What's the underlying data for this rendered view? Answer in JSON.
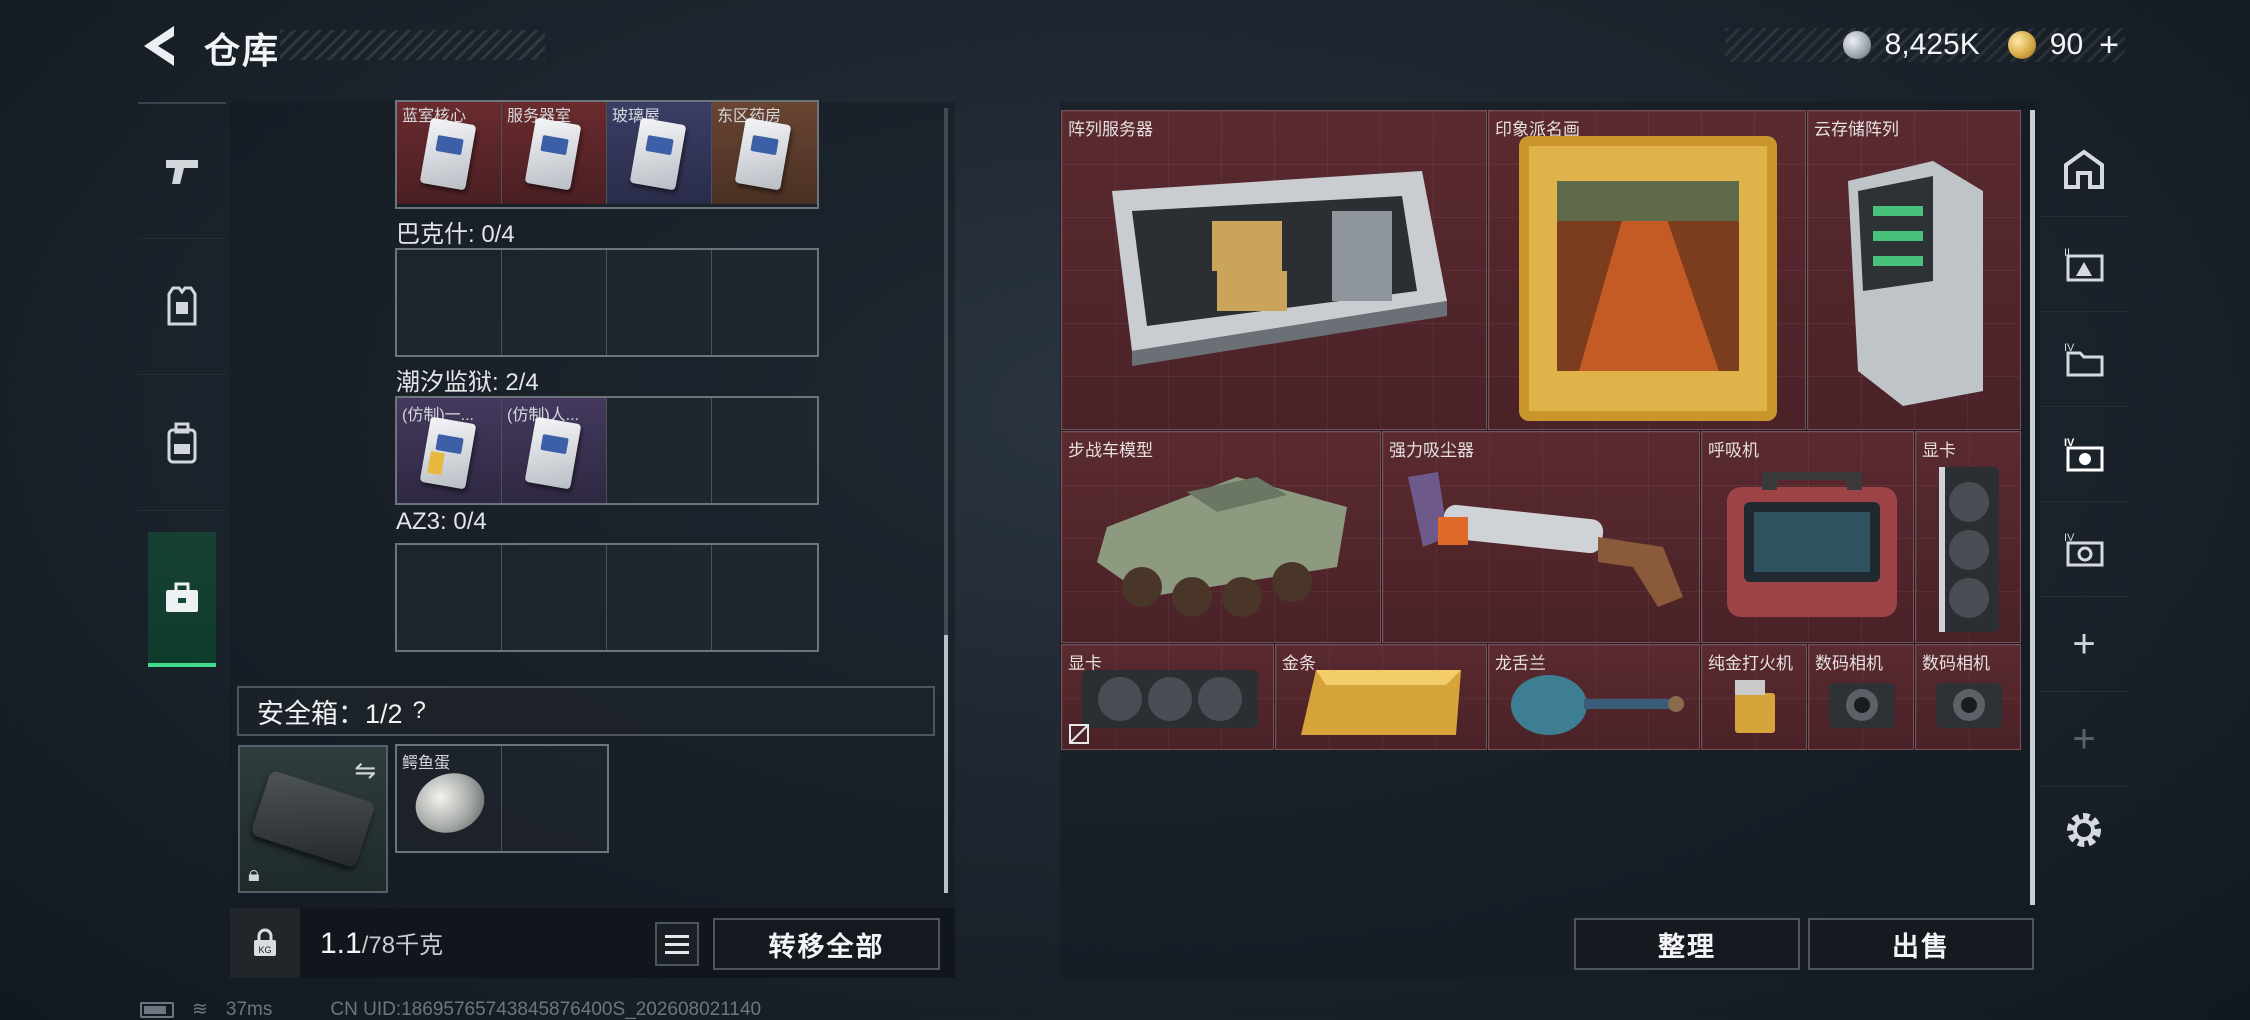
{
  "header": {
    "title": "仓库"
  },
  "currency": {
    "silver": "8,425K",
    "gold": "90",
    "gold_plus": "+"
  },
  "left_tabs": [
    {
      "icon": "pistol-icon"
    },
    {
      "icon": "armor-icon"
    },
    {
      "icon": "backpack-icon"
    },
    {
      "icon": "briefcase-icon",
      "active": true
    }
  ],
  "key_groups": [
    {
      "label": "",
      "slots": [
        "蓝室核心",
        "服务器室",
        "玻璃屋",
        "东区药房"
      ]
    },
    {
      "label": "巴克什: 0/4",
      "slots": [
        "",
        "",
        "",
        ""
      ]
    },
    {
      "label": "潮汐监狱: 2/4",
      "slots": [
        "(仿制)一...",
        "(仿制)人...",
        "",
        ""
      ]
    },
    {
      "label": "AZ3: 0/4",
      "slots": [
        "",
        "",
        "",
        ""
      ]
    }
  ],
  "safe_box": {
    "label": "安全箱：1/2",
    "help": "?",
    "item": "鳄鱼蛋"
  },
  "weight": {
    "value": "1.1",
    "unit": "/78千克"
  },
  "buttons": {
    "transfer_all": "转移全部",
    "organize": "整理",
    "sell": "出售"
  },
  "stash_items": [
    {
      "name": "阵列服务器",
      "icon": "server-icon"
    },
    {
      "name": "印象派名画",
      "icon": "painting-icon"
    },
    {
      "name": "云存储阵列",
      "icon": "storage-array-icon"
    },
    {
      "name": "步战车模型",
      "icon": "ifv-model-icon"
    },
    {
      "name": "强力吸尘器",
      "icon": "vacuum-icon"
    },
    {
      "name": "呼吸机",
      "icon": "ventilator-icon"
    },
    {
      "name": "显卡",
      "icon": "gpu-icon"
    },
    {
      "name": "显卡",
      "icon": "gpu-icon"
    },
    {
      "name": "金条",
      "icon": "gold-bar-icon"
    },
    {
      "name": "龙舌兰",
      "icon": "tequila-icon"
    },
    {
      "name": "纯金打火机",
      "icon": "lighter-icon"
    },
    {
      "name": "数码相机",
      "icon": "camera-icon"
    },
    {
      "name": "数码相机",
      "icon": "camera-icon"
    }
  ],
  "right_tabs": [
    "house-icon",
    "stash-1-icon",
    "stash-2-icon",
    "stash-3-icon",
    "stash-4-icon",
    "+",
    "+",
    "settings-icon"
  ],
  "status": {
    "ping": "37ms",
    "uid": "CN UID:18695765743845876400S_202608021140"
  }
}
